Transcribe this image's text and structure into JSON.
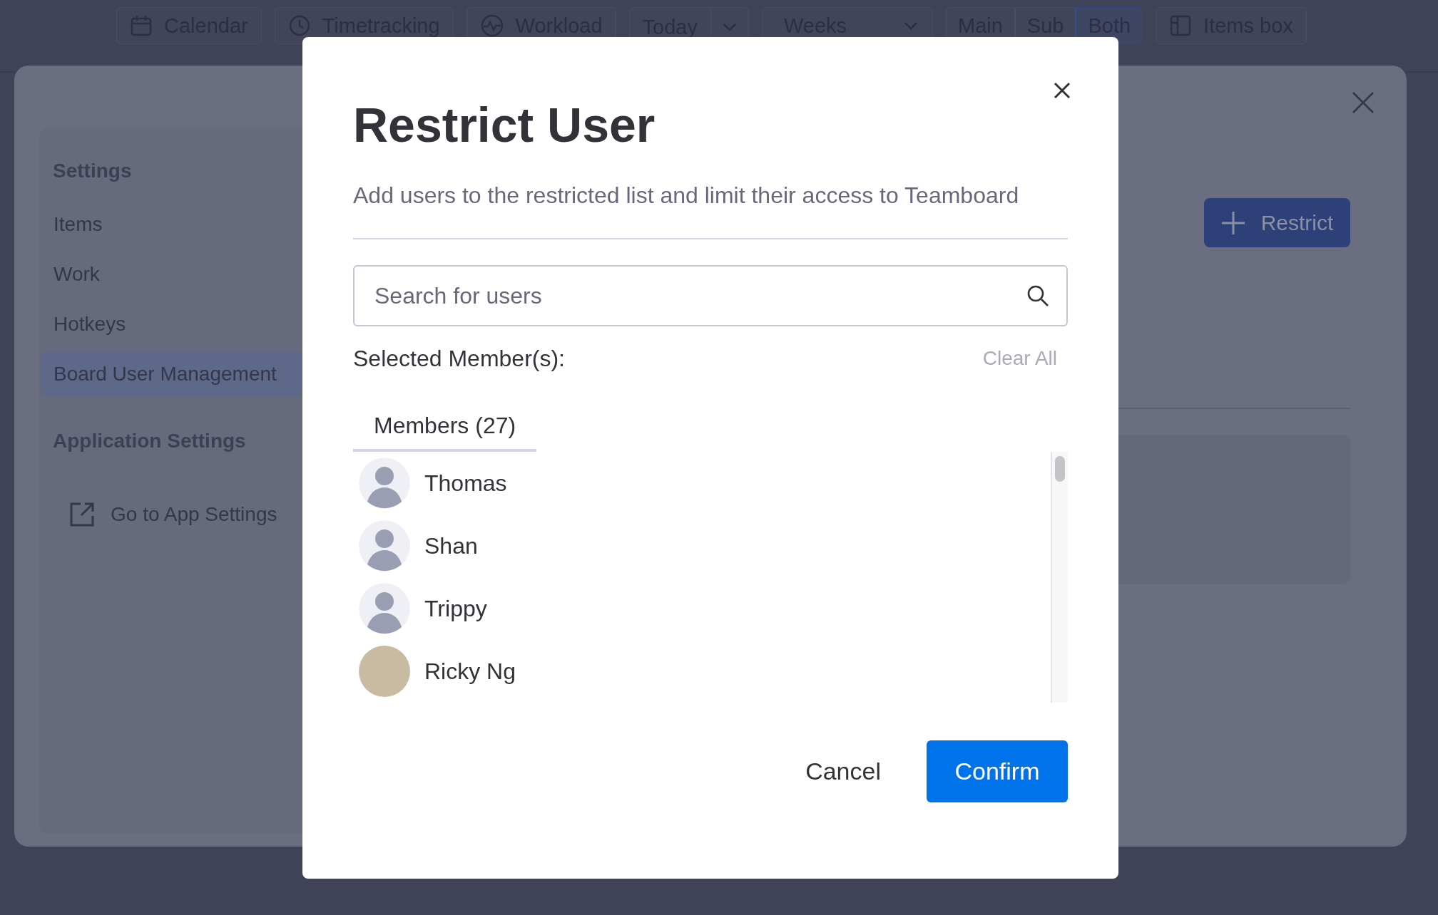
{
  "toolbar": [
    {
      "kind": "button",
      "label": "Calendar"
    },
    {
      "kind": "button",
      "label": "Timetracking"
    },
    {
      "kind": "button",
      "label": "Workload"
    },
    {
      "kind": "split",
      "label": "Today"
    },
    {
      "kind": "dropdown",
      "label": "Weeks"
    },
    {
      "kind": "segmented",
      "options": [
        {
          "label": "Main",
          "selected": false
        },
        {
          "label": "Sub",
          "selected": false
        },
        {
          "label": "Both",
          "selected": true
        }
      ]
    },
    {
      "kind": "button",
      "label": "Items box"
    }
  ],
  "settings_panel": {
    "sidebar": {
      "sections": [
        {
          "heading": "Settings",
          "items": [
            {
              "kind": "page",
              "label": "Items",
              "selected": false
            },
            {
              "kind": "page",
              "label": "Work",
              "selected": false
            },
            {
              "kind": "page",
              "label": "Hotkeys",
              "selected": false
            },
            {
              "kind": "page",
              "label": "Board User Management",
              "selected": true
            }
          ]
        },
        {
          "heading": "Application Settings",
          "items": [
            {
              "kind": "external",
              "label": "Go to App Settings",
              "selected": false
            }
          ]
        }
      ]
    },
    "restrict_button": "Restrict"
  },
  "modal": {
    "title": "Restrict User",
    "description": "Add users to the restricted list and limit their access to Teamboard",
    "search": {
      "placeholder": "Search for users"
    },
    "selected_label": "Selected Member(s):",
    "clear_all": {
      "label": "Clear All",
      "disabled": true
    },
    "tabs": [
      {
        "label": "Members (27)",
        "selected": true
      }
    ],
    "members": [
      {
        "name": "Thomas",
        "kind": "illustration"
      },
      {
        "name": "Shan",
        "kind": "illustration"
      },
      {
        "name": "Trippy",
        "kind": "illustration"
      },
      {
        "name": "Ricky Ng",
        "kind": "photo"
      }
    ],
    "buttons": [
      {
        "kind": "secondary",
        "label": "Cancel"
      },
      {
        "kind": "primary",
        "label": "Confirm"
      }
    ]
  }
}
